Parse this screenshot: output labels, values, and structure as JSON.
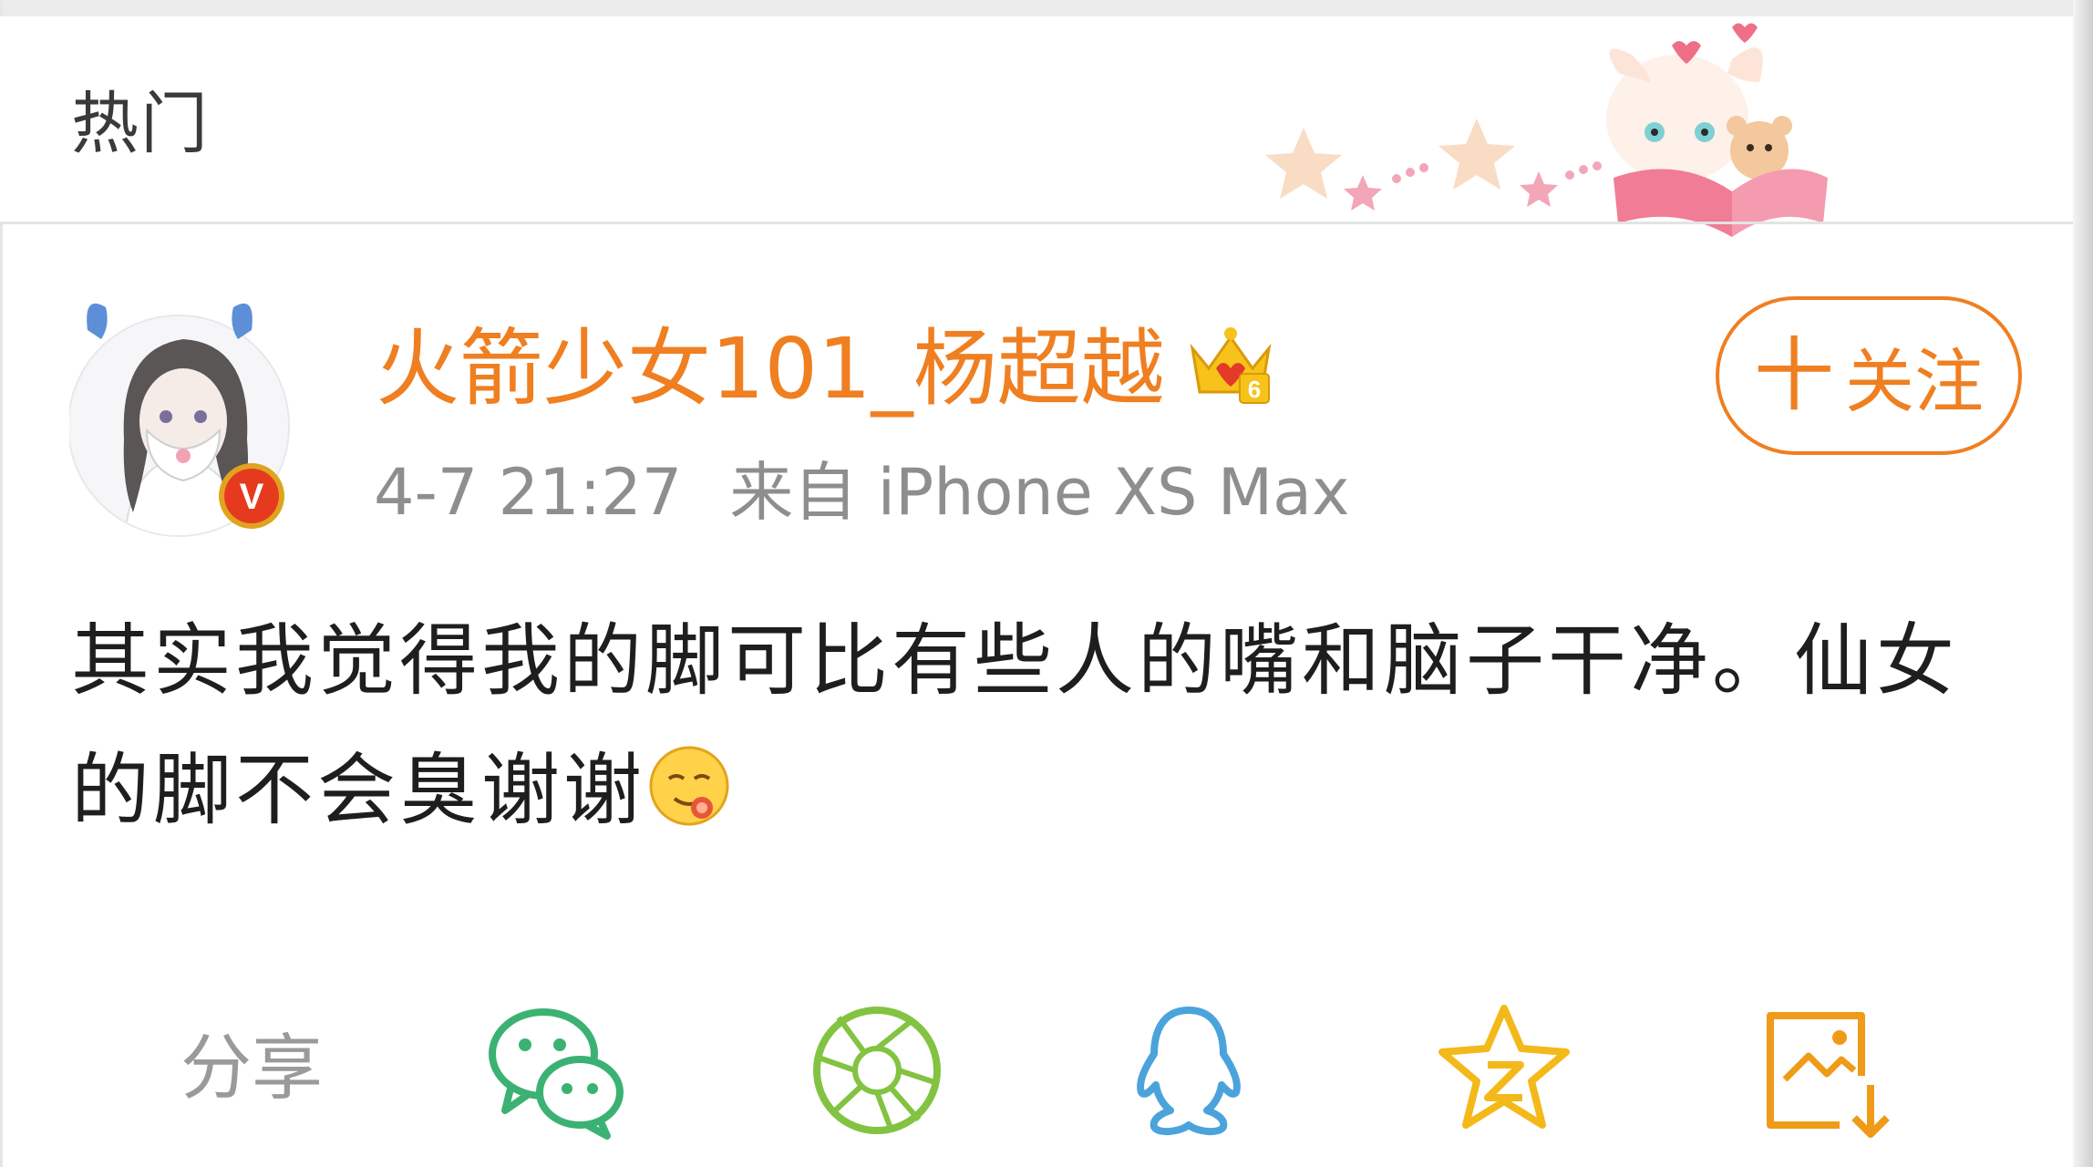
{
  "header": {
    "title": "热门"
  },
  "post": {
    "author": {
      "name": "火箭少女101_杨超越",
      "verified_badge": "V",
      "crown_level": "6"
    },
    "time": "4-7 21:27",
    "source": "来自 iPhone XS Max",
    "follow_button": {
      "plus": "十",
      "label": "关注"
    },
    "text": "其实我觉得我的脚可比有些人的嘴和脑子干净。仙女的脚不会臭谢谢"
  },
  "share": {
    "label": "分享",
    "targets": [
      "wechat-icon",
      "moments-icon",
      "qq-icon",
      "qzone-icon",
      "save-image-icon"
    ]
  },
  "colors": {
    "accent": "#ef7f21",
    "text": "#1e1e1e",
    "muted": "#8e8e8e",
    "wechat": "#3bb273",
    "moments": "#82c341",
    "qq": "#4ba3dc",
    "qzone": "#f3b91a",
    "save": "#ef9b18"
  }
}
